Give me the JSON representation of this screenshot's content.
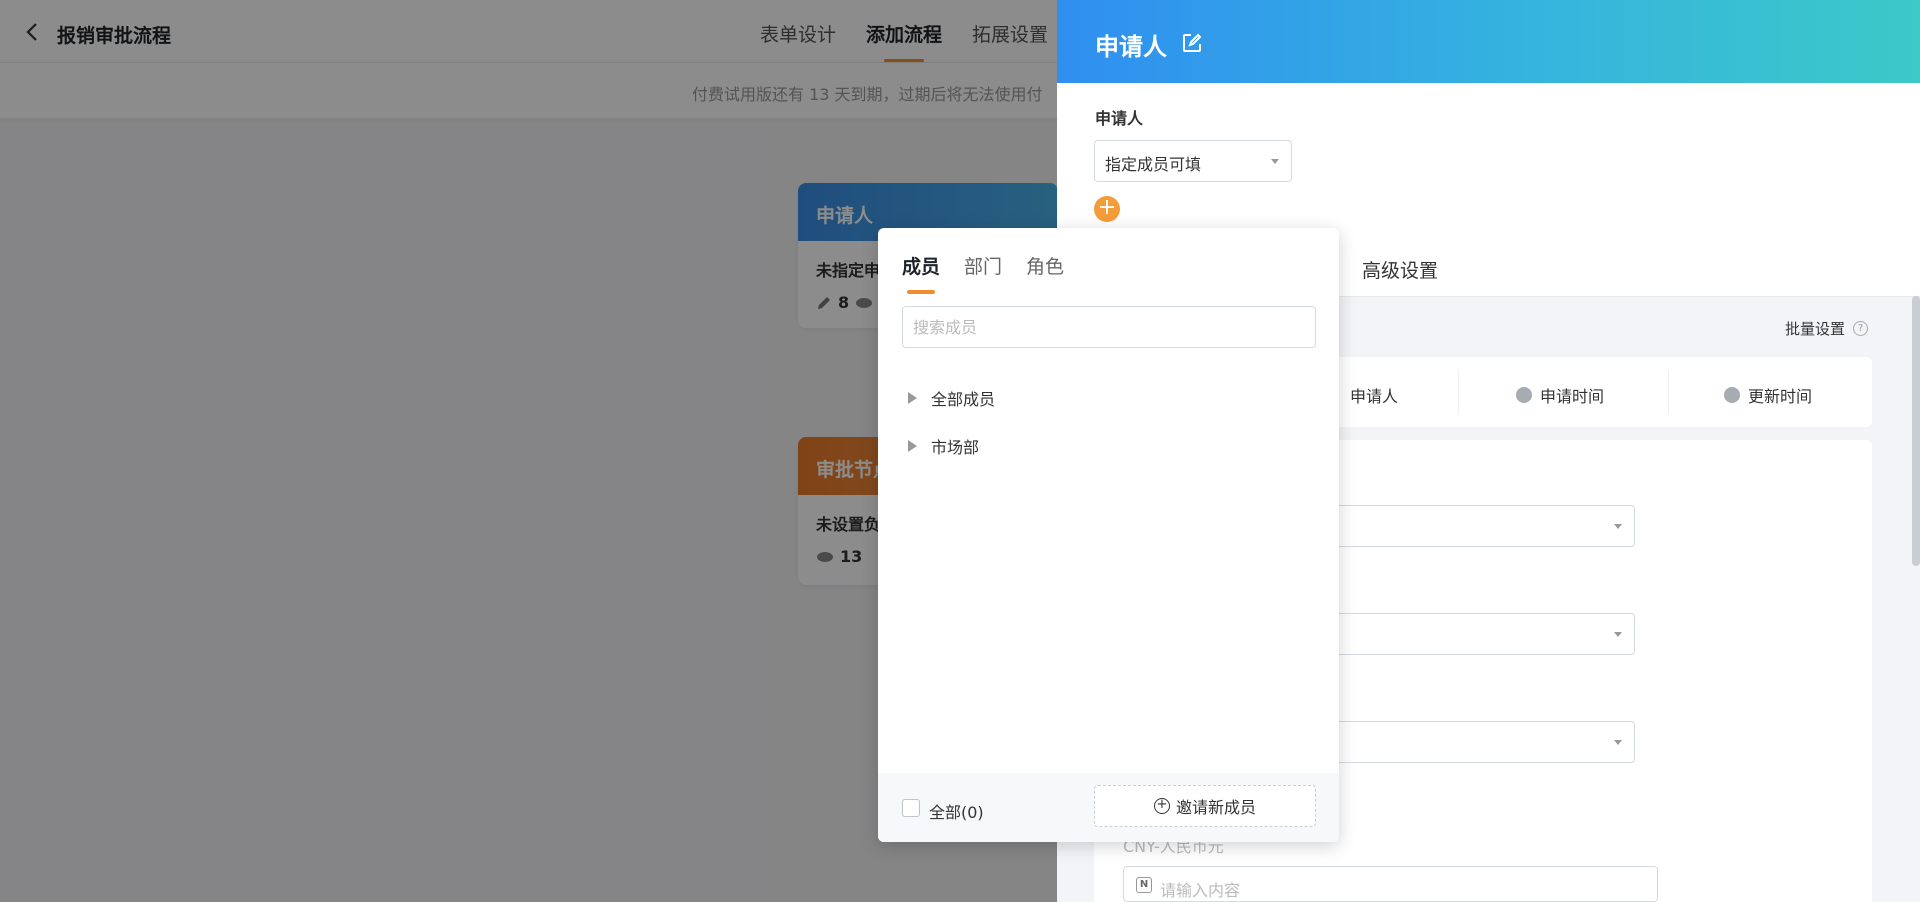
{
  "app": {
    "title": "报销审批流程",
    "tabs": [
      "表单设计",
      "添加流程",
      "拓展设置"
    ],
    "active_tab": "添加流程",
    "trial_text": "付费试用版还有 13 天到期，过期后将无法使用付"
  },
  "flow": {
    "node1": {
      "title": "申请人",
      "subtitle": "未指定申",
      "count": "8"
    },
    "node2": {
      "title": "审批节点",
      "subtitle": "未设置负",
      "count": "13"
    }
  },
  "drawer": {
    "title": "申请人",
    "field_label": "申请人",
    "select_value": "指定成员可填",
    "add_label": "+",
    "advanced_tab": "高级设置",
    "batch_label": "批量设置",
    "help_glyph": "?",
    "system_fields": [
      "申请人",
      "申请时间",
      "更新时间"
    ],
    "currency_label": "CNY-人民币元",
    "content_placeholder": "请输入内容",
    "input_icon_glyph": "N"
  },
  "picker": {
    "tabs": [
      "成员",
      "部门",
      "角色"
    ],
    "active_tab": "成员",
    "search_placeholder": "搜索成员",
    "tree": [
      "全部成员",
      "市场部"
    ],
    "select_all_label": "全部(0)",
    "invite_label": "邀请新成员",
    "invite_icon_glyph": "+"
  },
  "colors": {
    "accent": "#f08c2e",
    "header_start": "#2f8ff0",
    "header_end": "#3cc9c8",
    "node_blue": "#3a8ee6",
    "node_orange": "#ea7a2c"
  }
}
